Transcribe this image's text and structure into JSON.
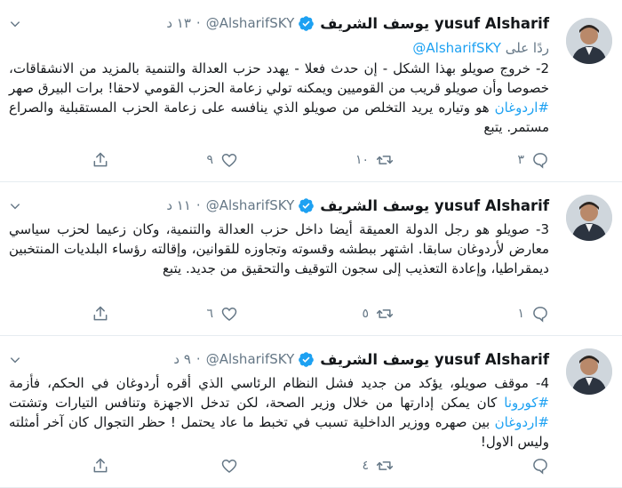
{
  "tweets": [
    {
      "name": "yusuf Alsharif يوسف الشريف",
      "handle": "@AlsharifSKY",
      "dot": "·",
      "time": "١٣ د",
      "reply_prefix": "ردًا على",
      "reply_mention": "@AlsharifSKY",
      "body_parts": [
        "2- خروج صويلو بهذا الشكل - إن حدث فعلا - يهدد حزب العدالة والتنمية بالمزيد من الانشقاقات، خصوصا وأن صويلو قريب من القوميين ويمكنه تولي زعامة الحزب القومي لاحقا! برات البيرق صهر ",
        "#اردوغان",
        " هو وتياره يريد التخلص من صويلو الذي ينافسه على زعامة الحزب المستقبلية والصراع مستمر. ",
        "يتبع"
      ],
      "replies": "٣",
      "retweets": "١٠",
      "likes": "٩"
    },
    {
      "name": "yusuf Alsharif يوسف الشريف",
      "handle": "@AlsharifSKY",
      "dot": "·",
      "time": "١١ د",
      "body_parts": [
        "3- صويلو هو رجل الدولة العميقة أيضا داخل حزب العدالة والتنمية، وكان زعيما لحزب سياسي معارض لأردوغان سابقا. اشتهر ببطشه وقسوته وتجاوزه للقوانين، وإقالته رؤساء البلديات المنتخبين ديمقراطيا، وإعادة التعذيب إلى سجون التوقيف والتحقيق من جديد. ",
        "يتبع"
      ],
      "replies": "١",
      "retweets": "٥",
      "likes": "٦"
    },
    {
      "name": "yusuf Alsharif يوسف الشريف",
      "handle": "@AlsharifSKY",
      "dot": "·",
      "time": "٩ د",
      "body_parts": [
        "4- موقف صويلو، يؤكد من جديد فشل النظام الرئاسي الذي أقره أردوغان في الحكم، فأزمة ",
        "#كورونا",
        " كان يمكن إدارتها من خلال وزير الصحة، لكن تدخل الاجهزة وتنافس التيارات وتشتت ",
        "#اردوغان",
        " بين صهره ووزير الداخلية تسبب في تخبط ما عاد يحتمل ! حظر التجوال كان آخر أمثلته وليس الاول!"
      ],
      "replies": "",
      "retweets": "٤",
      "likes": ""
    }
  ],
  "icons": {
    "verified": "verified-badge-icon",
    "caret": "chevron-down-icon",
    "reply": "reply-icon",
    "retweet": "retweet-icon",
    "like": "heart-icon",
    "share": "share-icon"
  },
  "colors": {
    "accent": "#1da1f2",
    "secondary_text": "#657786",
    "primary_text": "#14171a",
    "divider": "#e6ecf0"
  }
}
